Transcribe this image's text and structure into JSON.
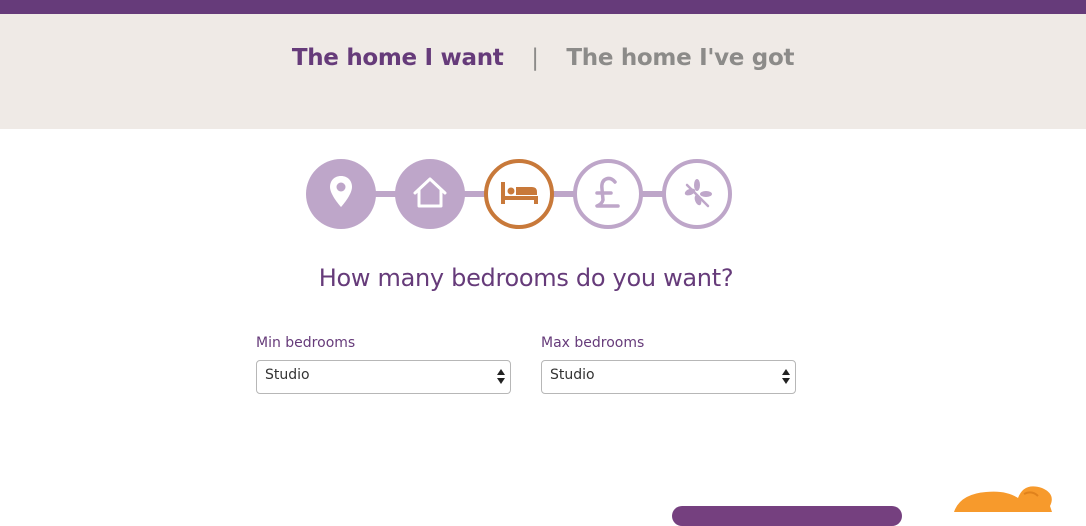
{
  "header": {
    "tabs": [
      {
        "label": "The home I want",
        "active": true
      },
      {
        "label": "The home I've got",
        "active": false
      }
    ],
    "separator": "|"
  },
  "steps": [
    {
      "icon": "location-pin-icon",
      "state": "complete"
    },
    {
      "icon": "house-icon",
      "state": "complete"
    },
    {
      "icon": "bed-icon",
      "state": "current"
    },
    {
      "icon": "pound-icon",
      "state": "upcoming"
    },
    {
      "icon": "leaf-icon",
      "state": "upcoming"
    }
  ],
  "question": "How many bedrooms do you want?",
  "form": {
    "min": {
      "label": "Min bedrooms",
      "value": "Studio"
    },
    "max": {
      "label": "Max bedrooms",
      "value": "Studio"
    }
  },
  "colors": {
    "brand_purple": "#663b7a",
    "step_lilac": "#bea6c9",
    "active_step_orange": "#c8793a",
    "panel_beige": "#efeae6",
    "mascot_orange": "#f79a2c"
  }
}
